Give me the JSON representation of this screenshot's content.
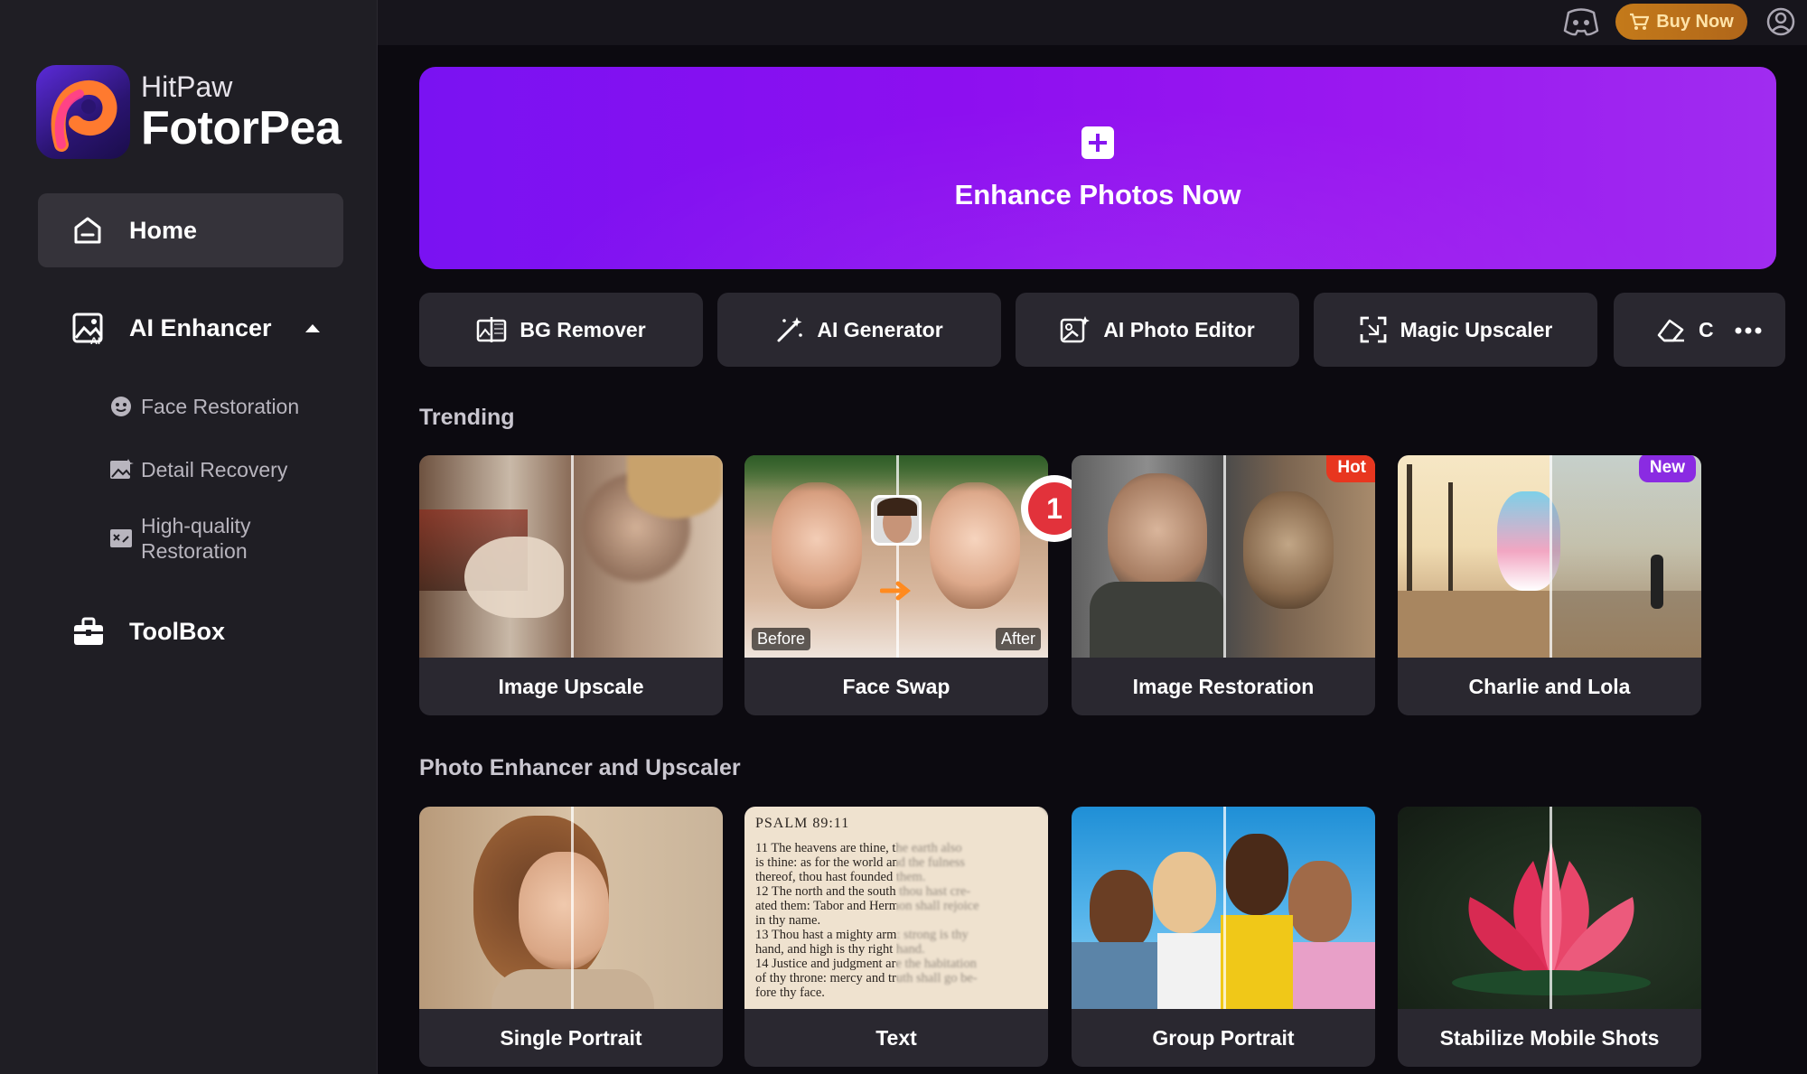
{
  "window": {
    "controls": [
      "close",
      "minimize"
    ]
  },
  "topbar": {
    "discord_icon": "discord-icon",
    "buy_now": "Buy Now",
    "account_icon": "user-circle-icon"
  },
  "sidebar": {
    "brand_small": "HitPaw",
    "brand_big": "FotorPea",
    "home": "Home",
    "ai_enhancer": "AI Enhancer",
    "sub_items": [
      "Face Restoration",
      "Detail Recovery",
      "High-quality",
      "Restoration"
    ],
    "toolbox": "ToolBox"
  },
  "hero": {
    "title": "Enhance Photos Now"
  },
  "tools": [
    {
      "label": "BG Remover",
      "icon": "bg-remover-icon"
    },
    {
      "label": "AI Generator",
      "icon": "magic-wand-icon"
    },
    {
      "label": "AI Photo Editor",
      "icon": "photo-edit-icon"
    },
    {
      "label": "Magic Upscaler",
      "icon": "expand-icon"
    },
    {
      "label": "C",
      "icon": "eraser-icon"
    }
  ],
  "sections": {
    "trending": "Trending",
    "photo_enhancer": "Photo Enhancer and Upscaler"
  },
  "trending_cards": [
    {
      "label": "Image Upscale",
      "tag": ""
    },
    {
      "label": "Face Swap",
      "tag": "",
      "before": "Before",
      "after": "After"
    },
    {
      "label": "Image Restoration",
      "tag": "Hot"
    },
    {
      "label": "Charlie and Lola",
      "tag": "New"
    }
  ],
  "enhancer_cards": [
    {
      "label": "Single Portrait"
    },
    {
      "label": "Text"
    },
    {
      "label": "Group Portrait"
    },
    {
      "label": "Stabilize Mobile Shots"
    }
  ],
  "step_badge": "1",
  "psalm": {
    "head": "PSALM 89:11",
    "lines": [
      "11  The heavens are thine, the earth also",
      "is thine: as for the world and the fulness",
      "thereof, thou hast founded them.",
      "12  The north and the south thou hast cre-",
      "ated them: Tabor and Hermon shall rejoice",
      "in thy name.",
      "13  Thou hast a mighty arm: strong is thy",
      "hand, and high is thy right hand.",
      "14  Justice and judgment are the habitation",
      "of thy throne: mercy and truth shall go be-",
      "fore thy face."
    ]
  },
  "colors": {
    "accent_purple": "#8d0ff0",
    "hot_tag": "#e8361f",
    "new_tag": "#8a2be2",
    "buy_now": "#c47a1a"
  }
}
